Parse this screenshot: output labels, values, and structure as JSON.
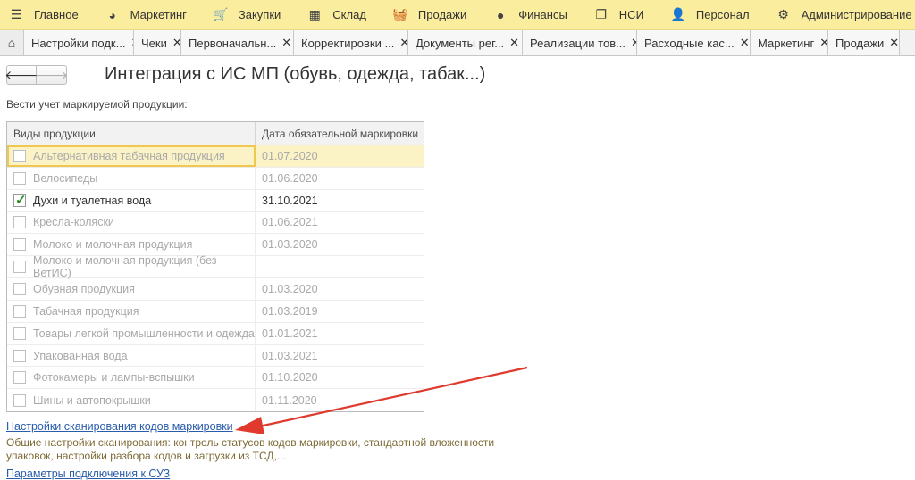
{
  "menu": [
    {
      "icon": "hamburger-icon",
      "glyph": "☰",
      "label": "Главное"
    },
    {
      "icon": "marketing-icon",
      "glyph": "◕",
      "label": "Маркетинг"
    },
    {
      "icon": "cart-icon",
      "glyph": "🛒",
      "label": "Закупки"
    },
    {
      "icon": "warehouse-icon",
      "glyph": "▦",
      "label": "Склад"
    },
    {
      "icon": "basket-icon",
      "glyph": "🧺",
      "label": "Продажи"
    },
    {
      "icon": "finance-icon",
      "glyph": "●",
      "label": "Финансы"
    },
    {
      "icon": "books-icon",
      "glyph": "❐",
      "label": "НСИ"
    },
    {
      "icon": "person-icon",
      "glyph": "👤",
      "label": "Персонал"
    },
    {
      "icon": "gear-icon",
      "glyph": "⚙",
      "label": "Администрирование"
    }
  ],
  "tabs": [
    {
      "label": "Настройки подк...",
      "width": 123
    },
    {
      "label": "Чеки",
      "width": 53
    },
    {
      "label": "Первоначальн...",
      "width": 126
    },
    {
      "label": "Корректировки ...",
      "width": 128
    },
    {
      "label": "Документы рег...",
      "width": 128
    },
    {
      "label": "Реализации тов...",
      "width": 128
    },
    {
      "label": "Расходные кас...",
      "width": 127
    },
    {
      "label": "Маркетинг",
      "width": 87
    },
    {
      "label": "Продажи",
      "width": 80
    }
  ],
  "page": {
    "title": "Интеграция с ИС МП (обувь, одежда, табак...)",
    "section_label": "Вести учет маркируемой продукции:"
  },
  "table": {
    "headers": [
      "Виды продукции",
      "Дата обязательной маркировки"
    ],
    "rows": [
      {
        "name": "Альтернативная табачная продукция",
        "date": "01.07.2020",
        "checked": false,
        "selected": true
      },
      {
        "name": "Велосипеды",
        "date": "01.06.2020",
        "checked": false
      },
      {
        "name": "Духи и туалетная вода",
        "date": "31.10.2021",
        "checked": true
      },
      {
        "name": "Кресла-коляски",
        "date": "01.06.2021",
        "checked": false
      },
      {
        "name": "Молоко и молочная продукция",
        "date": "01.03.2020",
        "checked": false
      },
      {
        "name": "Молоко и молочная продукция (без ВетИС)",
        "date": "",
        "checked": false
      },
      {
        "name": "Обувная продукция",
        "date": "01.03.2020",
        "checked": false
      },
      {
        "name": "Табачная продукция",
        "date": "01.03.2019",
        "checked": false
      },
      {
        "name": "Товары легкой промышленности и одежда",
        "date": "01.01.2021",
        "checked": false
      },
      {
        "name": "Упакованная вода",
        "date": "01.03.2021",
        "checked": false
      },
      {
        "name": "Фотокамеры и лампы-вспышки",
        "date": "01.10.2020",
        "checked": false
      },
      {
        "name": "Шины и автопокрышки",
        "date": "01.11.2020",
        "checked": false
      }
    ]
  },
  "links": {
    "scan_settings": "Настройки сканирования кодов маркировки",
    "scan_settings_desc": "Общие настройки сканирования: контроль статусов кодов маркировки, стандартной вложенности упаковок, настройки разбора кодов и загрузки из ТСД,...",
    "suz_params": "Параметры подключения к СУЗ"
  },
  "colors": {
    "menu_bg": "#fbed9e",
    "link": "#2a5cab",
    "arrow": "#e03a2f",
    "check": "#2a8f2a"
  }
}
